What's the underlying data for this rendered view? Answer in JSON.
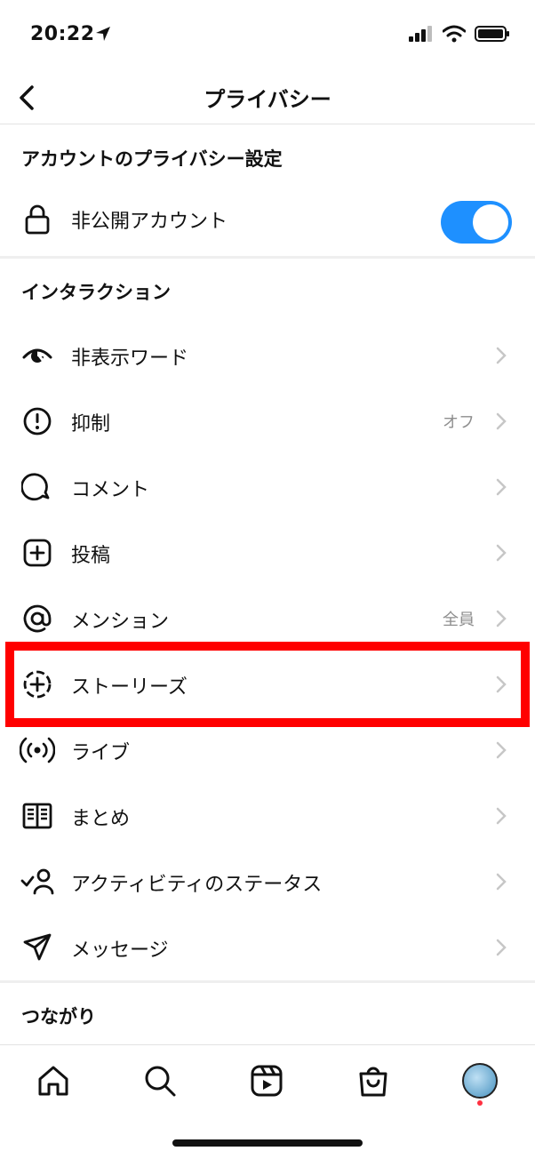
{
  "status": {
    "time": "20:22"
  },
  "header": {
    "title": "プライバシー"
  },
  "sections": {
    "account": "アカウントのプライバシー設定",
    "interaction": "インタラクション",
    "connections": "つながり"
  },
  "account": {
    "private_label": "非公開アカウント",
    "private_enabled": true
  },
  "items": [
    {
      "label": "非表示ワード",
      "value": "",
      "icon": "eye-slash-icon"
    },
    {
      "label": "抑制",
      "value": "オフ",
      "icon": "alert-circle-icon"
    },
    {
      "label": "コメント",
      "value": "",
      "icon": "comment-icon"
    },
    {
      "label": "投稿",
      "value": "",
      "icon": "plus-square-icon"
    },
    {
      "label": "メンション",
      "value": "全員",
      "icon": "at-icon"
    },
    {
      "label": "ストーリーズ",
      "value": "",
      "icon": "story-plus-icon"
    },
    {
      "label": "ライブ",
      "value": "",
      "icon": "live-icon"
    },
    {
      "label": "まとめ",
      "value": "",
      "icon": "guide-book-icon"
    },
    {
      "label": "アクティビティのステータス",
      "value": "",
      "icon": "activity-user-icon"
    },
    {
      "label": "メッセージ",
      "value": "",
      "icon": "send-icon"
    }
  ],
  "colors": {
    "accent": "#1e90ff",
    "highlight": "#ff0000",
    "secondary_text": "#8e8e8e"
  }
}
